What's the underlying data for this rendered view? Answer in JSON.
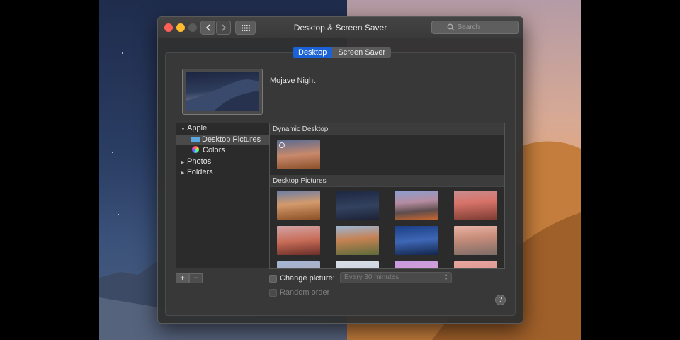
{
  "window": {
    "title": "Desktop & Screen Saver",
    "search_placeholder": "Search"
  },
  "tabs": [
    {
      "label": "Desktop",
      "active": true
    },
    {
      "label": "Screen Saver",
      "active": false
    }
  ],
  "current_wallpaper": {
    "name": "Mojave Night"
  },
  "source_list": [
    {
      "label": "Apple",
      "expanded": true,
      "icon": "disclosure-open"
    },
    {
      "label": "Desktop Pictures",
      "icon": "folder-icon",
      "selected": true
    },
    {
      "label": "Colors",
      "icon": "color-wheel-icon"
    },
    {
      "label": "Photos",
      "expanded": false,
      "icon": "disclosure-closed"
    },
    {
      "label": "Folders",
      "expanded": false,
      "icon": "disclosure-closed"
    }
  ],
  "sections": {
    "dynamic": {
      "title": "Dynamic Desktop"
    },
    "pictures": {
      "title": "Desktop Pictures"
    }
  },
  "controls": {
    "add_label": "+",
    "remove_label": "−",
    "change_picture_label": "Change picture:",
    "change_picture_checked": false,
    "interval_value": "Every 30 minutes",
    "random_order_label": "Random order",
    "random_order_checked": false,
    "help_label": "?"
  },
  "colors": {
    "accent": "#1a62d6",
    "close": "#fe5f57",
    "minimize": "#febc2e"
  }
}
